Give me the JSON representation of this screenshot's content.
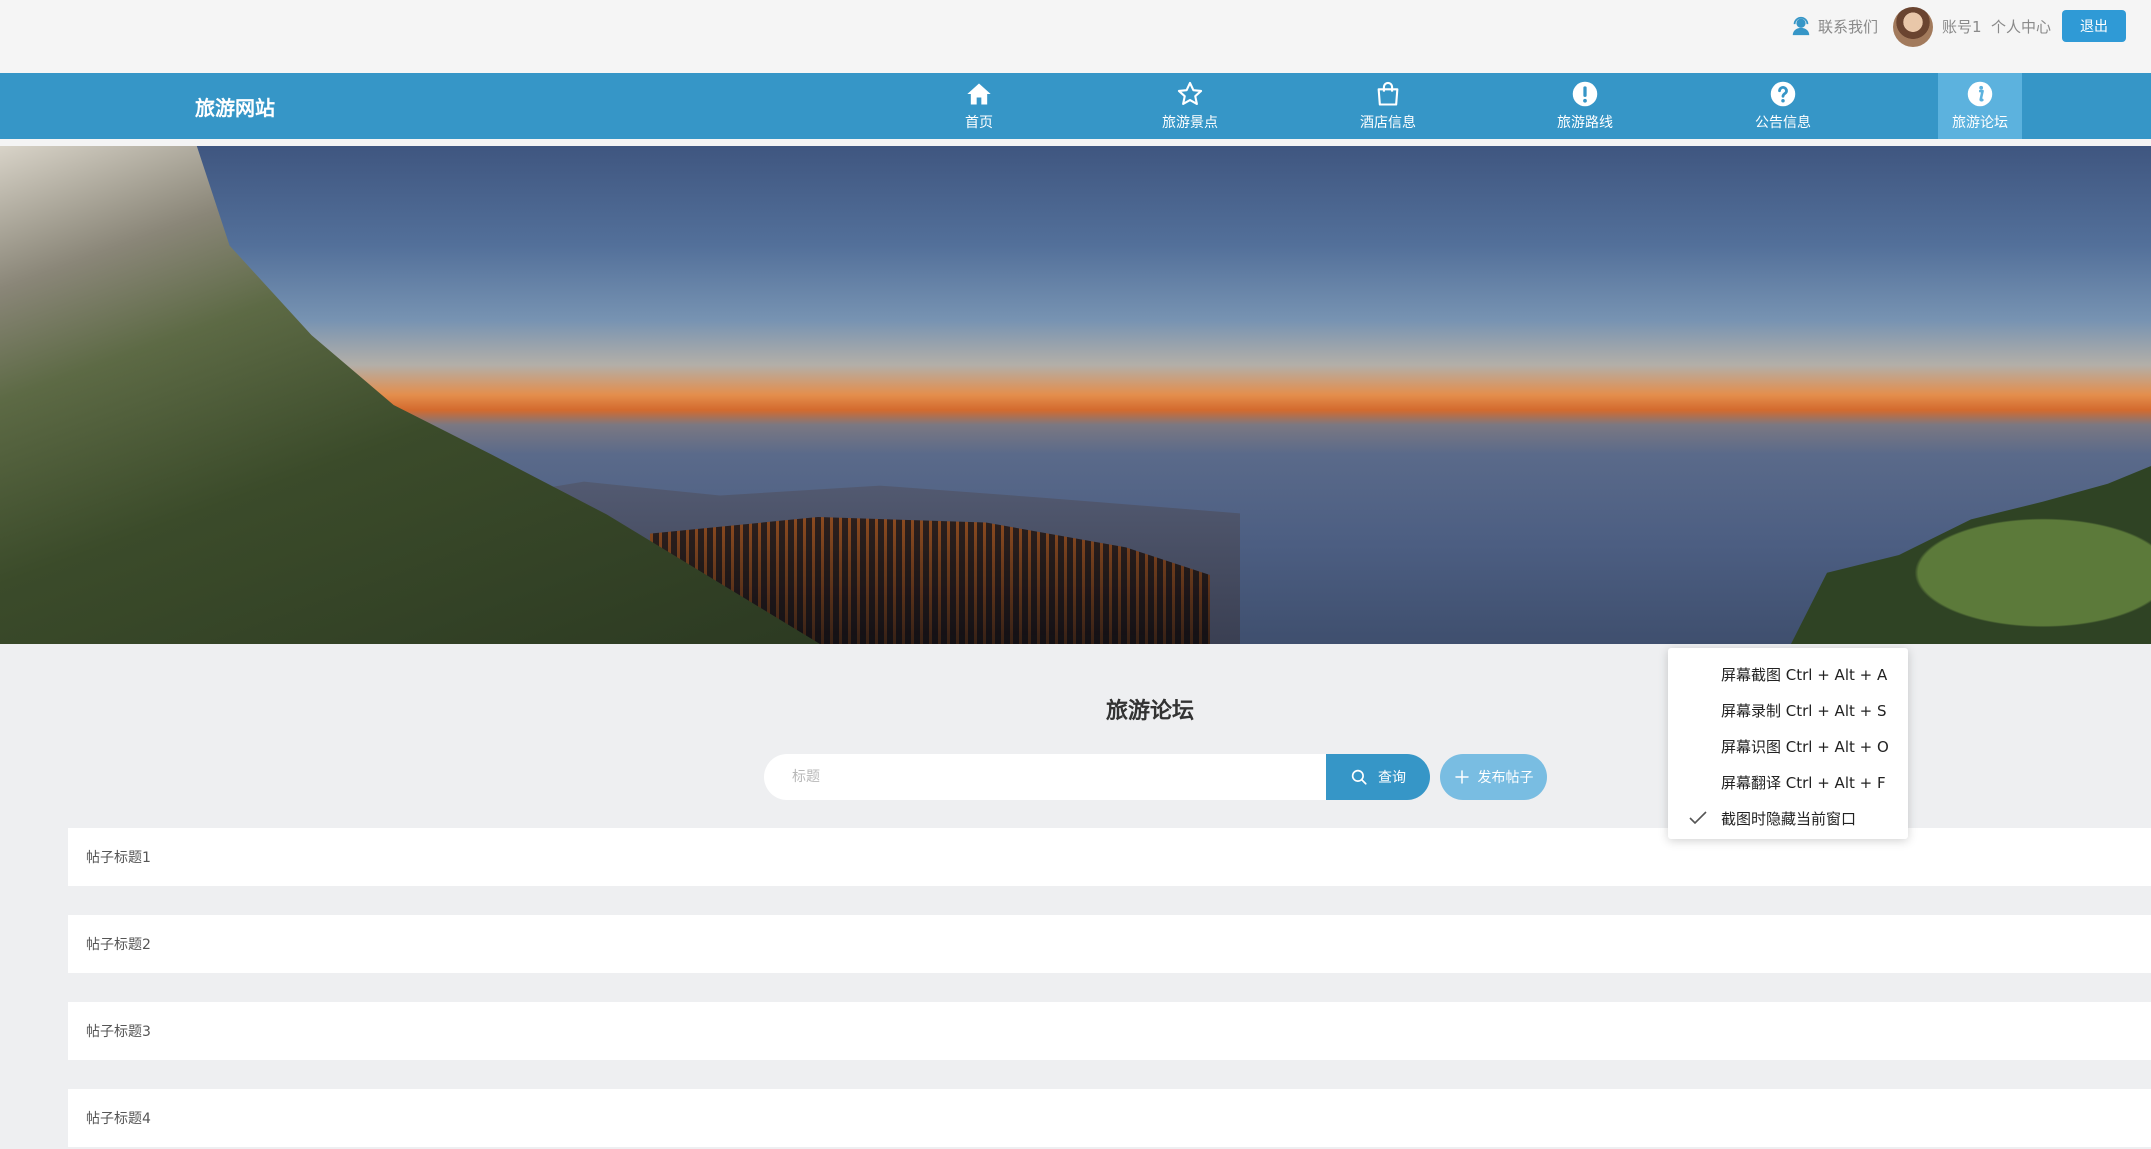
{
  "topbar": {
    "contact_label": "联系我们",
    "account_label": "账号1",
    "personal_center_label": "个人中心",
    "logout_label": "退出",
    "contact_icon": "customer-service-icon"
  },
  "nav": {
    "logo": "旅游网站",
    "items": [
      {
        "label": "首页",
        "icon": "home-icon"
      },
      {
        "label": "旅游景点",
        "icon": "star-icon"
      },
      {
        "label": "酒店信息",
        "icon": "shopping-bag-icon"
      },
      {
        "label": "旅游路线",
        "icon": "exclamation-circle-icon"
      },
      {
        "label": "公告信息",
        "icon": "question-circle-icon"
      },
      {
        "label": "旅游论坛",
        "icon": "info-circle-icon",
        "active": true
      }
    ],
    "accent_color": "#3696c7"
  },
  "banner": {
    "slide_count": 3,
    "active_slide": 3
  },
  "forum": {
    "title": "旅游论坛",
    "search_placeholder": "标题",
    "search_value": "",
    "search_button": "查询",
    "post_button": "发布帖子",
    "posts": [
      "帖子标题1",
      "帖子标题2",
      "帖子标题3",
      "帖子标题4"
    ]
  },
  "context_menu": {
    "items": [
      {
        "label": "屏幕截图 Ctrl + Alt + A",
        "checked": false
      },
      {
        "label": "屏幕录制 Ctrl + Alt + S",
        "checked": false
      },
      {
        "label": "屏幕识图 Ctrl + Alt + O",
        "checked": false
      },
      {
        "label": "屏幕翻译 Ctrl + Alt + F",
        "checked": false
      },
      {
        "label": "截图时隐藏当前窗口",
        "checked": true
      }
    ]
  }
}
